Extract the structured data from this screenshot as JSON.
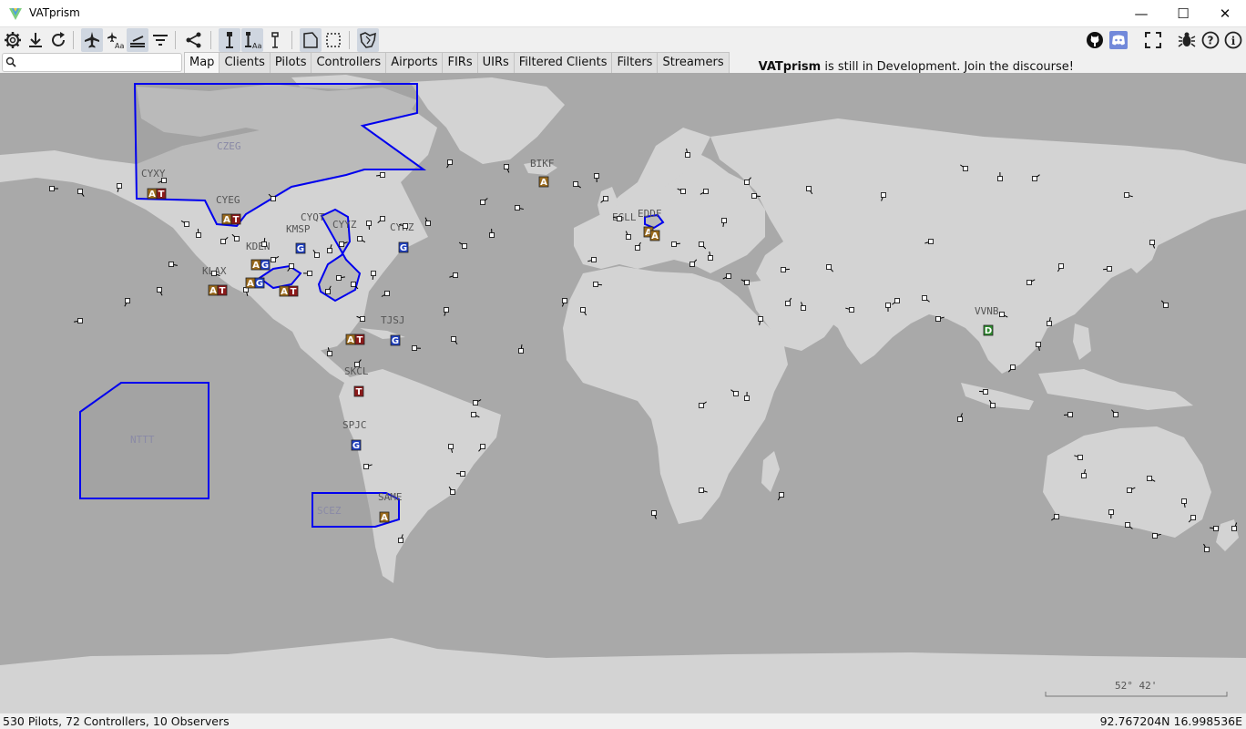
{
  "window": {
    "title": "VATprism",
    "minimize_glyph": "—",
    "maximize_glyph": "☐",
    "close_glyph": "✕"
  },
  "toolbar": {
    "icons": [
      "gear-icon",
      "download-icon",
      "refresh-icon",
      "airplane-icon",
      "airplane-label-icon",
      "runway-icon",
      "filter-lines-icon",
      "share-icon",
      "controller-icon",
      "controller-label-icon",
      "tower-icon",
      "fir-shape-icon",
      "uir-shape-icon",
      "map-shape-icon"
    ],
    "announcement_app": "VATprism",
    "announcement_text": " is still in Development. Join the discourse!",
    "right_icons": [
      "github-icon",
      "discord-icon",
      "fullscreen-icon",
      "bug-icon",
      "help-icon",
      "info-icon"
    ]
  },
  "search": {
    "placeholder": "",
    "value": ""
  },
  "tabs": [
    {
      "label": "Map",
      "active": true
    },
    {
      "label": "Clients"
    },
    {
      "label": "Pilots"
    },
    {
      "label": "Controllers"
    },
    {
      "label": "Airports"
    },
    {
      "label": "FIRs"
    },
    {
      "label": "UIRs"
    },
    {
      "label": "Filtered Clients"
    },
    {
      "label": "Filters"
    },
    {
      "label": "Streamers"
    }
  ],
  "map": {
    "ocean_color": "#a9a9a9",
    "land_color": "#d3d3d3",
    "fir_color": "#0000ee",
    "fir_labels": [
      "CZEG",
      "NTTT",
      "SCEZ"
    ],
    "airport_labels": [
      "CYXY",
      "CYEG",
      "BIKF",
      "CYQT",
      "KMSP",
      "CYYZ",
      "CYHZ",
      "KDEN",
      "KLAX",
      "TJSJ",
      "SKCL",
      "SPJC",
      "SAME",
      "EDDF",
      "EGLL",
      "VVNB"
    ],
    "badges": [
      {
        "id": "CYXY",
        "text": "AT"
      },
      {
        "id": "CYEG",
        "text": "AT"
      },
      {
        "id": "BIKF",
        "text": "A"
      },
      {
        "id": "KLAX",
        "text": "AT"
      },
      {
        "id": "KSFO",
        "text": "AG"
      },
      {
        "id": "KDEN",
        "text": "AG"
      },
      {
        "id": "KDFW",
        "text": "AT"
      },
      {
        "id": "KMIA",
        "text": "AT"
      },
      {
        "id": "TJSJ",
        "text": "G"
      },
      {
        "id": "SKCL",
        "text": "T"
      },
      {
        "id": "SPJC",
        "text": "G"
      },
      {
        "id": "SAME",
        "text": "A"
      },
      {
        "id": "VVNB",
        "text": "D"
      },
      {
        "id": "EGLL",
        "text": "A"
      },
      {
        "id": "EDDF",
        "text": "A"
      },
      {
        "id": "CYHZ",
        "text": "G"
      },
      {
        "id": "KMSP",
        "text": "G"
      }
    ],
    "badge_colors": {
      "A": "#9a6a1c",
      "T": "#8b1a1a",
      "G": "#1e3fbf",
      "D": "#2e8b2e"
    },
    "scale_label": "52° 42'"
  },
  "status": {
    "counts": "530 Pilots, 72 Controllers, 10 Observers",
    "coords": "92.767204N 16.998536E"
  }
}
